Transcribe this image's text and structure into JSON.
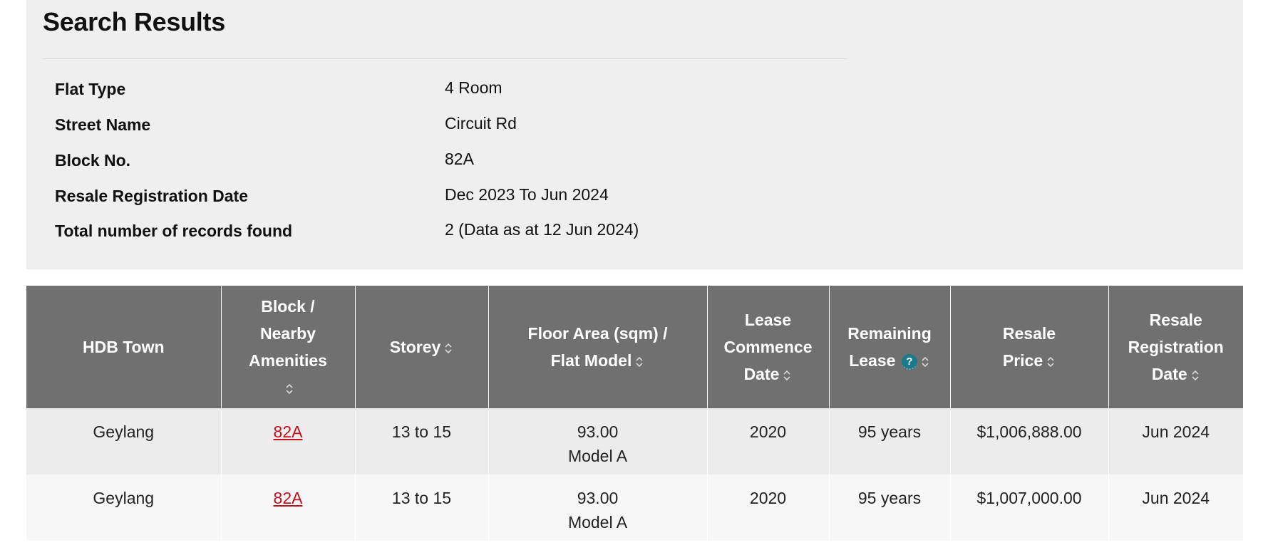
{
  "summary": {
    "title": "Search Results",
    "rows": [
      {
        "label": "Flat Type",
        "value": "4 Room"
      },
      {
        "label": "Street Name",
        "value": "Circuit Rd"
      },
      {
        "label": "Block No.",
        "value": "82A"
      },
      {
        "label": "Resale Registration Date",
        "value": "Dec 2023 To Jun 2024"
      },
      {
        "label": "Total number of records found",
        "value": "2 (Data as at 12 Jun 2024)"
      }
    ]
  },
  "table": {
    "headers": {
      "town": "HDB Town",
      "block_l1": "Block /",
      "block_l2": "Nearby",
      "block_l3": "Amenities",
      "storey": "Storey",
      "floor_l1": "Floor Area (sqm) /",
      "floor_l2": "Flat Model",
      "lease_l1": "Lease",
      "lease_l2": "Commence",
      "lease_l3": "Date",
      "remaining_l1": "Remaining",
      "remaining_l2": "Lease",
      "price_l1": "Resale",
      "price_l2": "Price",
      "regdate_l1": "Resale",
      "regdate_l2": "Registration",
      "regdate_l3": "Date"
    },
    "help_glyph": "?",
    "rows": [
      {
        "town": "Geylang",
        "block": "82A",
        "storey": "13 to 15",
        "floor_area": "93.00",
        "flat_model": "Model A",
        "lease_commence": "2020",
        "remaining_lease": "95 years",
        "price": "$1,006,888.00",
        "reg_date": "Jun 2024"
      },
      {
        "town": "Geylang",
        "block": "82A",
        "storey": "13 to 15",
        "floor_area": "93.00",
        "flat_model": "Model A",
        "lease_commence": "2020",
        "remaining_lease": "95 years",
        "price": "$1,007,000.00",
        "reg_date": "Jun 2024"
      }
    ]
  },
  "colors": {
    "header_bg": "#707070",
    "summary_bg": "#efefef",
    "link": "#c0111f",
    "help_icon": "#1a7a8a"
  },
  "icons": [
    "sort-icon",
    "help-icon"
  ]
}
